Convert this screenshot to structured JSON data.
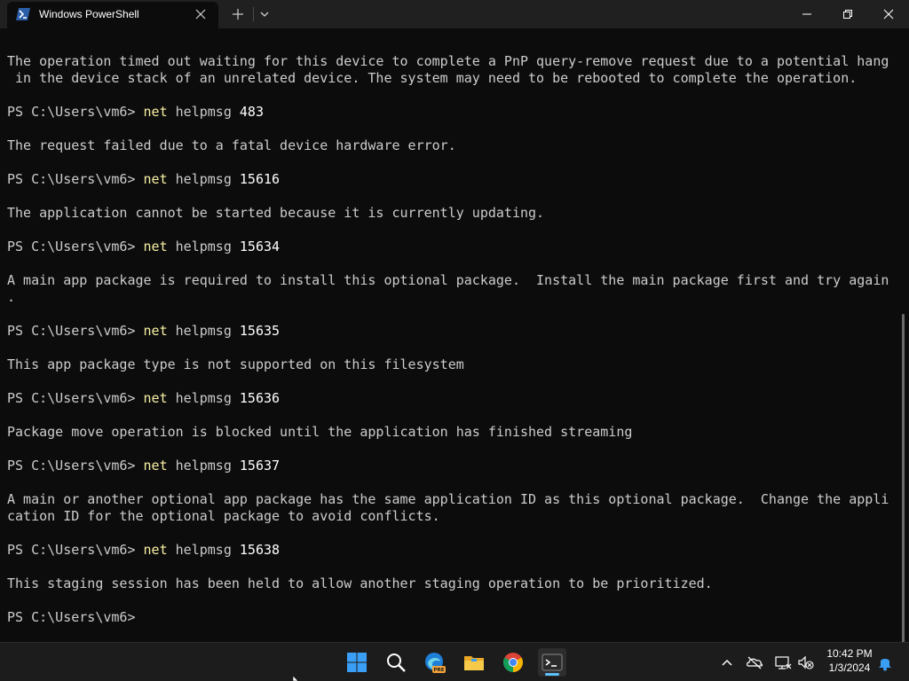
{
  "window": {
    "tab_title": "Windows PowerShell",
    "icons": {
      "tab": "powershell-icon",
      "tab_close": "close-icon",
      "new_tab": "plus-icon",
      "dropdown": "chevron-down-icon",
      "minimize": "minimize-icon",
      "maximize": "restore-icon",
      "close": "close-icon"
    }
  },
  "terminal": {
    "lines": [
      {
        "text": "The operation timed out waiting for this device to complete a PnP query-remove request due to a potential hang"
      },
      {
        "text": " in the device stack of an unrelated device. The system may need to be rebooted to complete the operation."
      },
      {
        "prompt": "PS C:\\Users\\vm6> ",
        "cmd": "net",
        "args": " helpmsg ",
        "num": "483"
      },
      {
        "text": "The request failed due to a fatal device hardware error."
      },
      {
        "prompt": "PS C:\\Users\\vm6> ",
        "cmd": "net",
        "args": " helpmsg ",
        "num": "15616"
      },
      {
        "text": "The application cannot be started because it is currently updating."
      },
      {
        "prompt": "PS C:\\Users\\vm6> ",
        "cmd": "net",
        "args": " helpmsg ",
        "num": "15634"
      },
      {
        "text": "A main app package is required to install this optional package.  Install the main package first and try again"
      },
      {
        "text": "."
      },
      {
        "prompt": "PS C:\\Users\\vm6> ",
        "cmd": "net",
        "args": " helpmsg ",
        "num": "15635"
      },
      {
        "text": "This app package type is not supported on this filesystem"
      },
      {
        "prompt": "PS C:\\Users\\vm6> ",
        "cmd": "net",
        "args": " helpmsg ",
        "num": "15636"
      },
      {
        "text": "Package move operation is blocked until the application has finished streaming"
      },
      {
        "prompt": "PS C:\\Users\\vm6> ",
        "cmd": "net",
        "args": " helpmsg ",
        "num": "15637"
      },
      {
        "text": "A main or another optional app package has the same application ID as this optional package.  Change the appli"
      },
      {
        "text": "cation ID for the optional package to avoid conflicts."
      },
      {
        "prompt": "PS C:\\Users\\vm6> ",
        "cmd": "net",
        "args": " helpmsg ",
        "num": "15638"
      },
      {
        "text": "This staging session has been held to allow another staging operation to be prioritized."
      },
      {
        "prompt": "PS C:\\Users\\vm6> ",
        "cmd": "",
        "args": "",
        "num": ""
      }
    ]
  },
  "taskbar": {
    "apps": [
      "windows-start-icon",
      "search-icon",
      "edge-beta-icon",
      "file-explorer-icon",
      "chrome-icon",
      "terminal-icon"
    ],
    "edge_badge": "PRE",
    "tray_icons": [
      "chevron-up-icon",
      "onedrive-icon",
      "network-icon",
      "speaker-muted-icon",
      "notification-bell-icon"
    ],
    "time": "10:42 PM",
    "date": "1/3/2024"
  }
}
